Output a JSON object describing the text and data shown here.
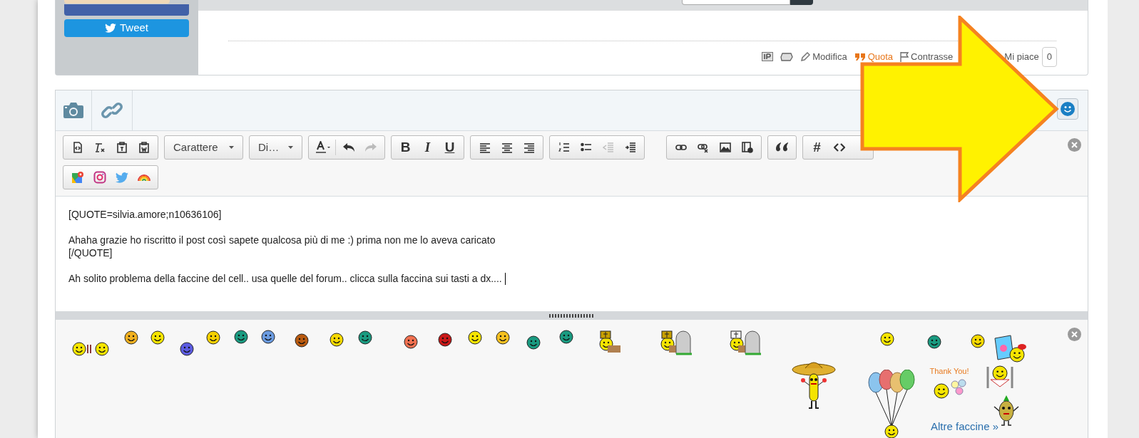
{
  "sidebar": {
    "tweet_button": "Tweet"
  },
  "post_actions": [
    {
      "kind": "edit",
      "label": "Modifica"
    },
    {
      "kind": "quote",
      "label": "Quota"
    },
    {
      "kind": "flag",
      "label": "Contrasse"
    },
    {
      "kind": "like",
      "label": "Mi piace"
    }
  ],
  "like_count": "0",
  "toolbar": {
    "font_dropdown": "Carattere",
    "size_dropdown": "Di…",
    "bold": "B",
    "italic": "I",
    "underline": "U",
    "hash": "#"
  },
  "editor": {
    "paragraphs": [
      {
        "lines": [
          "[QUOTE=silvia.amore;n10636106]"
        ]
      },
      {
        "lines": [
          "Ahaha grazie ho riscritto il post così sapete qualcosa più di me :) prima non me lo aveva caricato",
          "[/QUOTE]"
        ]
      },
      {
        "lines": [
          "Ah solito problema della faccine del cell.. usa quelle del forum.. clicca sulla faccina sui tasti a dx...."
        ]
      }
    ]
  },
  "smilies": {
    "thank_you": "Thank You!",
    "more_link": "Altre faccine »"
  }
}
